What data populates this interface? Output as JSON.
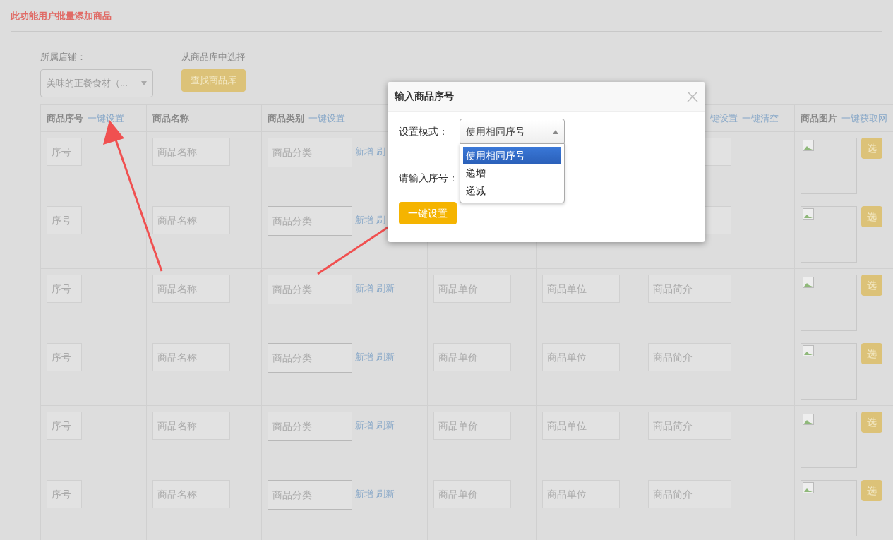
{
  "page_title": "此功能用户批量添加商品",
  "store": {
    "label": "所属店铺：",
    "value": "美味的正餐食材（..."
  },
  "library": {
    "label": "从商品库中选择",
    "button": "查找商品库"
  },
  "columns": [
    {
      "label": "商品序号",
      "actions": [
        "一键设置"
      ]
    },
    {
      "label": "商品名称"
    },
    {
      "label": "商品类别",
      "actions": [
        "一键设置"
      ]
    },
    {},
    {},
    {
      "actions": [
        "键设置",
        "一键清空"
      ]
    },
    {
      "label": "商品图片",
      "actions": [
        "一键获取网"
      ]
    }
  ],
  "rows": [
    {
      "seq": "序号",
      "name": "商品名称",
      "category": "商品分类",
      "links": [
        "新增",
        "刷"
      ],
      "select_button": "选"
    },
    {
      "seq": "序号",
      "name": "商品名称",
      "category": "商品分类",
      "links": [
        "新增",
        "刷"
      ],
      "select_button": "选"
    },
    {
      "seq": "序号",
      "name": "商品名称",
      "category": "商品分类",
      "links": [
        "新增",
        "刷新"
      ],
      "price": "商品单价",
      "unit": "商品单位",
      "intro": "商品简介",
      "select_button": "选"
    },
    {
      "seq": "序号",
      "name": "商品名称",
      "category": "商品分类",
      "links": [
        "新增",
        "刷新"
      ],
      "price": "商品单价",
      "unit": "商品单位",
      "intro": "商品简介",
      "select_button": "选"
    },
    {
      "seq": "序号",
      "name": "商品名称",
      "category": "商品分类",
      "links": [
        "新增",
        "刷新"
      ],
      "price": "商品单价",
      "unit": "商品单位",
      "intro": "商品简介",
      "select_button": "选"
    },
    {
      "seq": "序号",
      "name": "商品名称",
      "category": "商品分类",
      "links": [
        "新增",
        "刷新"
      ],
      "price": "商品单价",
      "unit": "商品单位",
      "intro": "商品简介",
      "select_button": "选"
    }
  ],
  "modal": {
    "title": "输入商品序号",
    "fields": [
      {
        "kind": "select",
        "label": "设置模式：",
        "value": "使用相同序号",
        "expanded": true,
        "options": [
          {
            "label": "使用相同序号",
            "selected": true
          },
          {
            "label": "递增",
            "selected": false
          },
          {
            "label": "递减",
            "selected": false
          }
        ]
      },
      {
        "kind": "input",
        "label": "请输入序号："
      }
    ],
    "button": "一键设置"
  }
}
